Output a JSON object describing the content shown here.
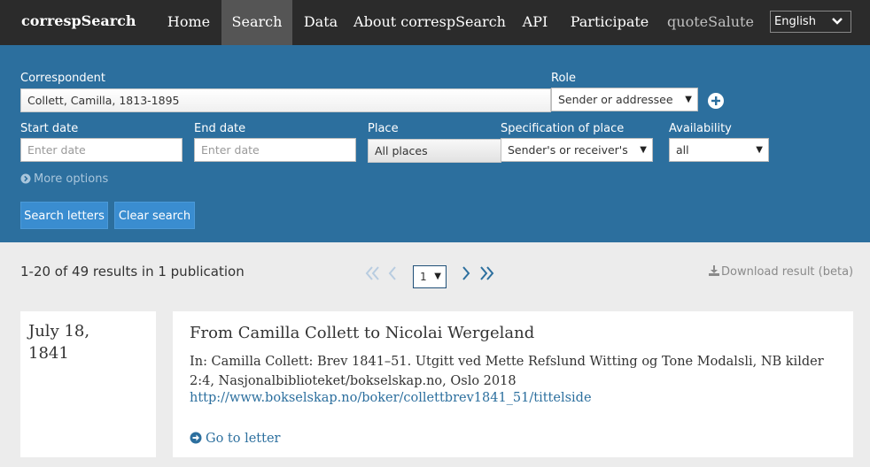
{
  "brand": "correspSearch",
  "nav": {
    "items": [
      {
        "label": "Home",
        "active": false
      },
      {
        "label": "Search",
        "active": true
      },
      {
        "label": "Data",
        "active": false
      },
      {
        "label": "About correspSearch",
        "active": false
      },
      {
        "label": "API",
        "active": false
      },
      {
        "label": "Participate",
        "active": false
      },
      {
        "label": "quoteSalute",
        "active": false,
        "muted": true
      }
    ],
    "language": "English"
  },
  "search": {
    "correspondent_label": "Correspondent",
    "correspondent_value": "Collett, Camilla, 1813-1895",
    "role_label": "Role",
    "role_value": "Sender or addressee",
    "start_date_label": "Start date",
    "start_date_placeholder": "Enter date",
    "end_date_label": "End date",
    "end_date_placeholder": "Enter date",
    "place_label": "Place",
    "place_value": "All places",
    "place_spec_label": "Specification of place",
    "place_spec_value": "Sender's or receiver's",
    "availability_label": "Availability",
    "availability_value": "all",
    "more_options": "More options",
    "search_button": "Search letters",
    "clear_button": "Clear search"
  },
  "results": {
    "count_text": "1-20 of 49 results in 1 publication",
    "page": "1",
    "download": "Download result (beta)"
  },
  "letter": {
    "date_line1": "July 18,",
    "date_line2": "1841",
    "title": "From Camilla Collett to Nicolai Wergeland",
    "source": "In: Camilla Collett: Brev 1841–51. Utgitt ved Mette Refslund Witting og Tone Modalsli, NB kilder 2:4, Nasjonalbiblioteket/bokselskap.no, Oslo 2018",
    "url": "http://www.bokselskap.no/boker/collettbrev1841_51/tittelside",
    "go_to_letter": "Go to letter"
  },
  "colors": {
    "nav_bg": "#2b2b2b",
    "panel_bg": "#2c6f9e",
    "button_bg": "#3a8dd0",
    "page_bg": "#ececec"
  },
  "icons": [
    "plus-circle-icon",
    "chevron-circle-right-icon",
    "double-chevron-left-icon",
    "chevron-left-icon",
    "chevron-right-icon",
    "double-chevron-right-icon",
    "download-icon",
    "arrow-circle-right-icon",
    "chevron-down-icon"
  ]
}
